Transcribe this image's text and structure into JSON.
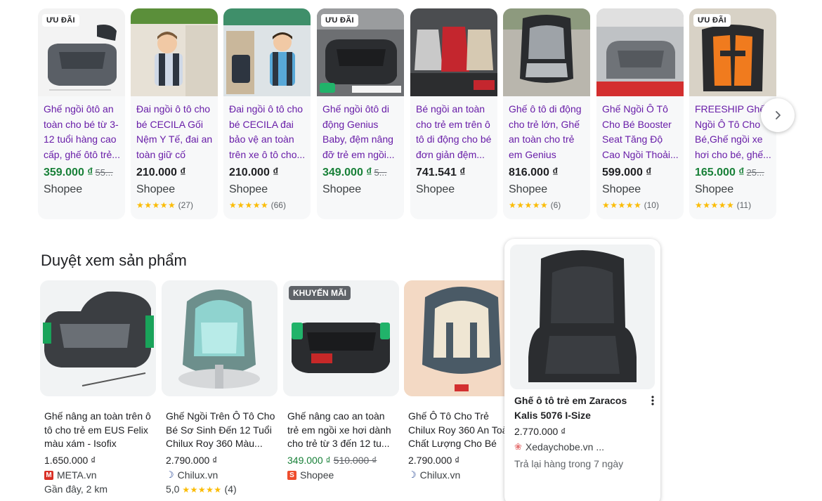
{
  "carousel": {
    "items": [
      {
        "badge": "ƯU ĐÃI",
        "title": "Ghế ngồi ôtô an toàn cho bé từ 3-12 tuổi hàng cao cấp, ghế ôtô trẻ...",
        "price": "359.000 ₫",
        "old_price": "55...",
        "seller": "Shopee",
        "stars": "",
        "reviews": ""
      },
      {
        "badge": "",
        "title": "Đai ngồi ô tô cho bé CECILA Gối Nệm Y Tế, đai an toàn giữ cố định...",
        "price": "210.000 ₫",
        "old_price": "",
        "seller": "Shopee",
        "stars": "★★★★★",
        "reviews": "(27)"
      },
      {
        "badge": "",
        "title": "Đai ngồi ô tô cho bé CECILA đai bảo vệ an toàn trên xe ô tô cho...",
        "price": "210.000 ₫",
        "old_price": "",
        "seller": "Shopee",
        "stars": "★★★★★",
        "reviews": "(66)"
      },
      {
        "badge": "ƯU ĐÃI",
        "title": "Ghế ngồi ôtô di động Genius Baby, đệm nâng đỡ trẻ em ngồi...",
        "price": "349.000 ₫",
        "old_price": "5...",
        "seller": "Shopee",
        "stars": "",
        "reviews": ""
      },
      {
        "badge": "",
        "title": "Bé ngồi an toàn cho trẻ em trên ô tô di động cho bé đơn giản đệm...",
        "price": "741.541 ₫",
        "old_price": "",
        "seller": "Shopee",
        "stars": "",
        "reviews": ""
      },
      {
        "badge": "",
        "title": "Ghế ô tô di động cho trẻ lớn, Ghế an toàn cho trẻ em Genius Baby...",
        "price": "816.000 ₫",
        "old_price": "",
        "seller": "Shopee",
        "stars": "★★★★★",
        "reviews": "(6)"
      },
      {
        "badge": "",
        "title": "Ghế Ngồi Ô Tô Cho Bé Booster Seat Tăng Độ Cao Ngồi Thoải...",
        "price": "599.000 ₫",
        "old_price": "",
        "seller": "Shopee",
        "stars": "★★★★★",
        "reviews": "(10)"
      },
      {
        "badge": "ƯU ĐÃI",
        "title": "FREESHIP Ghế Ngồi Ô Tô Cho Bé,Ghế ngồi xe hơi cho bé, ghế...",
        "price": "165.000 ₫",
        "old_price": "25...",
        "seller": "Shopee",
        "stars": "★★★★★",
        "reviews": "(11)"
      }
    ],
    "next_icon": "chevron-right-icon"
  },
  "browse": {
    "title": "Duyệt xem sản phẩm",
    "items": [
      {
        "badge": "",
        "title": "Ghế nâng an toàn trên ô tô cho trẻ em EUS Felix màu xám - Isofix",
        "price": "1.650.000 ₫",
        "old_price": "",
        "store": "META.vn",
        "extra": "Gần đây, 2 km",
        "rating": "",
        "stars": "",
        "reviews": ""
      },
      {
        "badge": "",
        "title": "Ghế Ngồi Trên Ô Tô Cho Bé Sơ Sinh Đến 12 Tuổi Chilux Roy 360 Màu...",
        "price": "2.790.000 ₫",
        "old_price": "",
        "store": "Chilux.vn",
        "extra": "",
        "rating": "5,0",
        "stars": "★★★★★",
        "reviews": "(4)"
      },
      {
        "badge": "KHUYẾN MÃI",
        "title": "Ghế nâng cao an toàn trẻ em ngồi xe hơi dành cho trẻ từ 3 đến 12 tu...",
        "price": "349.000 ₫",
        "old_price": "510.000 ₫",
        "store": "Shopee",
        "extra": "",
        "rating": "",
        "stars": "",
        "reviews": ""
      },
      {
        "badge": "",
        "title": "Ghế Ô Tô Cho Trẻ Chilux Roy 360 An Toàn Chất Lượng Cho Bé",
        "price": "2.790.000 ₫",
        "old_price": "",
        "store": "Chilux.vn",
        "extra": "",
        "rating": "",
        "stars": "",
        "reviews": ""
      }
    ]
  },
  "hover_card": {
    "title": "Ghế ô tô trẻ em Zaracos Kalis 5076 I-Size",
    "price": "2.770.000 ₫",
    "store": "Xedaychobe.vn ...",
    "return_policy": "Trả lại hàng trong 7 ngày",
    "more_icon": "more-vert-icon"
  },
  "colors": {
    "link_title": "#681da8",
    "sale_price": "#188038",
    "star": "#fbbc04",
    "card_bg": "#f7f8f9"
  }
}
